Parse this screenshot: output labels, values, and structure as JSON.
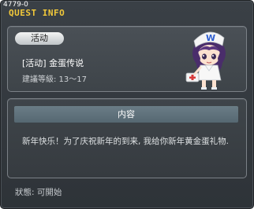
{
  "window": {
    "quest_id": "4779-0",
    "title": "QUEST INFO"
  },
  "quest": {
    "category_badge": "活动",
    "name": "[活动] 金蛋传说",
    "level_requirement": "建議等級: 13〜17"
  },
  "content": {
    "header": "内容",
    "text": "新年快乐！为了庆祝新年的到来, 我给你新年黄金蛋礼物."
  },
  "status": {
    "text": "狀態:  可開始"
  },
  "colors": {
    "title": "#f2c93a",
    "window_bg": "#2e3338",
    "header_bar": "#5f737d"
  },
  "icons": {
    "npc": "nurse-npc-portrait"
  }
}
